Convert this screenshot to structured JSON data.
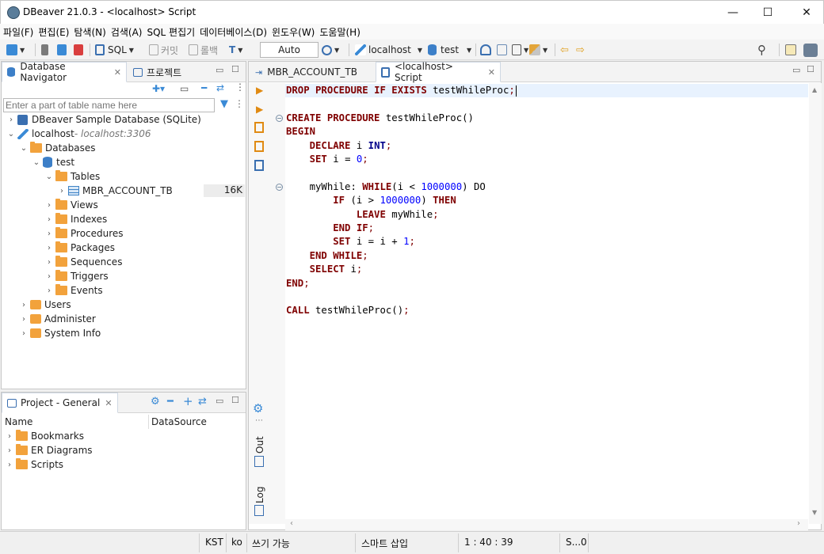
{
  "window": {
    "title": "DBeaver 21.0.3 - <localhost> Script",
    "minimize": "—",
    "maximize": "☐",
    "close": "✕"
  },
  "menu": [
    "파일(F)",
    "편집(E)",
    "탐색(N)",
    "검색(A)",
    "SQL 편집기",
    "데이터베이스(D)",
    "윈도우(W)",
    "도움말(H)"
  ],
  "toolbar": {
    "sql_label": "SQL",
    "commit_label": "커밋",
    "rollback_label": "롤백",
    "transaction_mode": "Auto",
    "connection": "localhost",
    "database": "test",
    "icons": [
      "new-connection-icon",
      "connect-icon",
      "disconnect-icon",
      "sql-editor-icon",
      "commit-icon",
      "rollback-icon",
      "transaction-history-icon",
      "server-icon",
      "database-icon",
      "dashboard-icon",
      "sql-template-icon",
      "tools-icon",
      "navigate-back-icon",
      "navigate-forward-icon",
      "search-icon",
      "perspective-icon",
      "dbeaver-perspective-icon"
    ]
  },
  "navigator": {
    "tab_label": "Database Navigator",
    "projects_tab_label": "프로젝트",
    "filter_placeholder": "Enter a part of table name here",
    "tree": [
      {
        "label": "DBeaver Sample Database (SQLite)",
        "depth": 0,
        "expanded": false,
        "icon": "sqlite-icon"
      },
      {
        "label": "localhost",
        "sublabel": " - localhost:3306",
        "depth": 0,
        "expanded": true,
        "icon": "mysql-icon"
      },
      {
        "label": "Databases",
        "depth": 1,
        "expanded": true,
        "icon": "databases-icon"
      },
      {
        "label": "test",
        "depth": 2,
        "expanded": true,
        "icon": "database-icon"
      },
      {
        "label": "Tables",
        "depth": 3,
        "expanded": true,
        "icon": "tables-folder-icon"
      },
      {
        "label": "MBR_ACCOUNT_TB",
        "depth": 4,
        "expanded": false,
        "icon": "table-icon",
        "size": "16K"
      },
      {
        "label": "Views",
        "depth": 3,
        "expanded": false,
        "icon": "views-folder-icon"
      },
      {
        "label": "Indexes",
        "depth": 3,
        "expanded": false,
        "icon": "folder-icon"
      },
      {
        "label": "Procedures",
        "depth": 3,
        "expanded": false,
        "icon": "folder-icon"
      },
      {
        "label": "Packages",
        "depth": 3,
        "expanded": false,
        "icon": "folder-icon"
      },
      {
        "label": "Sequences",
        "depth": 3,
        "expanded": false,
        "icon": "folder-icon"
      },
      {
        "label": "Triggers",
        "depth": 3,
        "expanded": false,
        "icon": "folder-icon"
      },
      {
        "label": "Events",
        "depth": 3,
        "expanded": false,
        "icon": "folder-icon"
      },
      {
        "label": "Users",
        "depth": 1,
        "expanded": false,
        "icon": "users-icon"
      },
      {
        "label": "Administer",
        "depth": 1,
        "expanded": false,
        "icon": "administer-icon"
      },
      {
        "label": "System Info",
        "depth": 1,
        "expanded": false,
        "icon": "system-info-icon"
      }
    ]
  },
  "project_panel": {
    "tab_label": "Project - General",
    "columns": [
      "Name",
      "DataSource"
    ],
    "items": [
      "Bookmarks",
      "ER Diagrams",
      "Scripts"
    ]
  },
  "editor": {
    "tabs": [
      {
        "label": "MBR_ACCOUNT_TB",
        "active": false
      },
      {
        "label": "<localhost> Script",
        "active": true
      }
    ],
    "side_labels": {
      "output": "Out",
      "log": "Log"
    },
    "lines": [
      "DROP PROCEDURE IF EXISTS testWhileProc;",
      "",
      "CREATE PROCEDURE testWhileProc()",
      "BEGIN",
      "    DECLARE i INT;",
      "    SET i = 0;",
      "",
      "    myWhile: WHILE(i < 1000000) DO",
      "        IF (i > 1000000) THEN",
      "            LEAVE myWhile;",
      "        END IF;",
      "        SET i = i + 1;",
      "    END WHILE;",
      "    SELECT i;",
      "END;",
      "",
      "CALL testWhileProc();"
    ]
  },
  "status": {
    "timezone": "KST",
    "locale": "ko",
    "write_mode": "쓰기 가능",
    "insert_mode": "스마트 삽입",
    "cursor_position": "1 : 40 : 39",
    "selection": "S...0"
  },
  "colors": {
    "keyword": "#7f0000",
    "keyword2": "#00008a",
    "number": "#0000ff",
    "folder": "#f2a23c",
    "accent": "#3c7fc8"
  }
}
